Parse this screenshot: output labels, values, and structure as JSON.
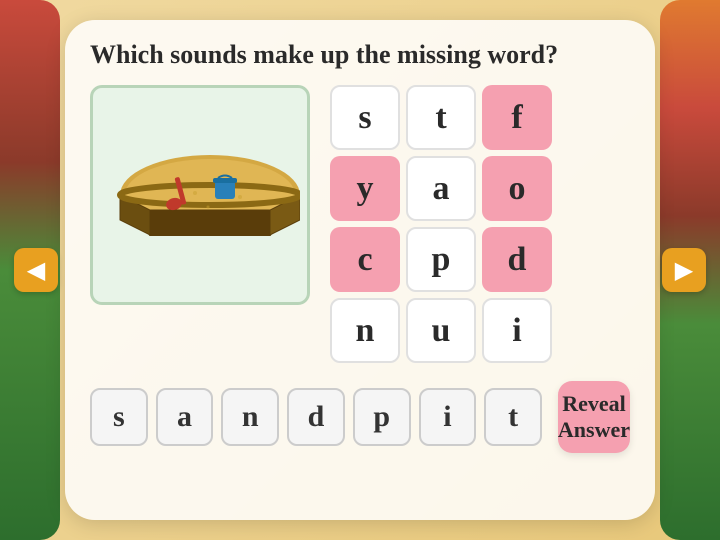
{
  "page": {
    "question": "Which sounds make up the missing word?",
    "nav": {
      "left_arrow": "◀",
      "right_arrow": "▶"
    },
    "grid": {
      "cells": [
        {
          "letter": "s",
          "style": "white",
          "row": 0,
          "col": 0
        },
        {
          "letter": "t",
          "style": "white",
          "row": 0,
          "col": 1
        },
        {
          "letter": "f",
          "style": "pink",
          "row": 0,
          "col": 2
        },
        {
          "letter": "y",
          "style": "pink",
          "row": 1,
          "col": 0
        },
        {
          "letter": "a",
          "style": "white",
          "row": 1,
          "col": 1
        },
        {
          "letter": "o",
          "style": "pink",
          "row": 1,
          "col": 2
        },
        {
          "letter": "c",
          "style": "pink",
          "row": 2,
          "col": 0
        },
        {
          "letter": "p",
          "style": "white",
          "row": 2,
          "col": 1
        },
        {
          "letter": "d",
          "style": "pink",
          "row": 2,
          "col": 2
        },
        {
          "letter": "n",
          "style": "white",
          "row": 3,
          "col": 0
        },
        {
          "letter": "u",
          "style": "white",
          "row": 3,
          "col": 1
        },
        {
          "letter": "i",
          "style": "white",
          "row": 3,
          "col": 2
        }
      ]
    },
    "answer_letters": [
      "s",
      "a",
      "n",
      "d",
      "p",
      "i",
      "t"
    ],
    "reveal_button": "Reveal Answer"
  }
}
